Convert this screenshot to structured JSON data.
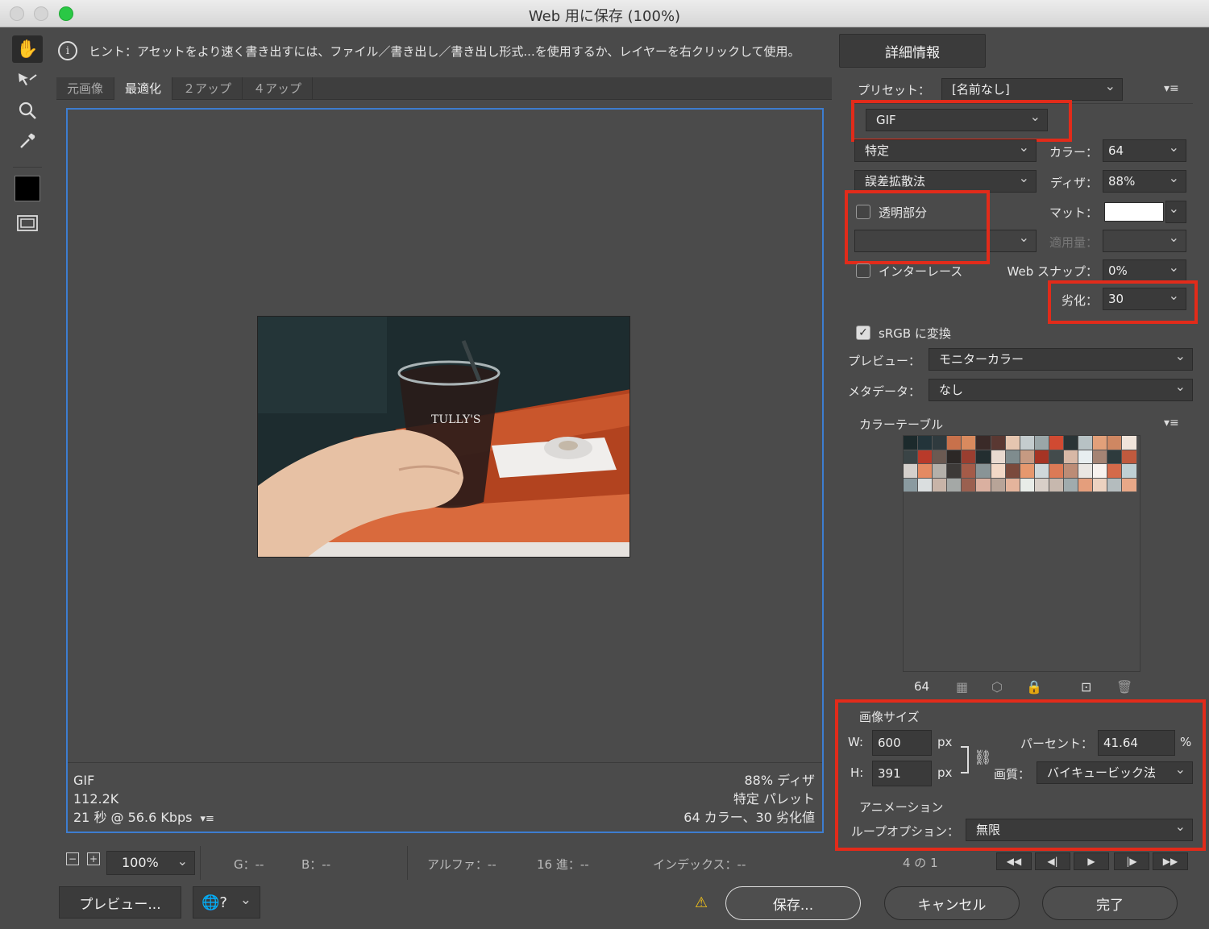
{
  "window": {
    "title": "Web 用に保存 (100%)"
  },
  "hint": {
    "text": "ヒント：アセットをより速く書き出すには、ファイル／書き出し／書き出し形式...を使用するか、レイヤーを右クリックして使用。"
  },
  "detail_button": "詳細情報",
  "tabs": [
    "元画像",
    "最適化",
    "２アップ",
    "４アップ"
  ],
  "canvas_info": {
    "format": "GIF",
    "size": "112.2K",
    "time": "21 秒 @ 56.6 Kbps",
    "dither": "88% ディザ",
    "palette": "特定 パレット",
    "colors": "64 カラー、30 劣化値"
  },
  "status": {
    "zoom": "100%",
    "g": "G：--",
    "b": "B：--",
    "alpha": "アルファ：--",
    "hex": "16 進：--",
    "index": "インデックス：--"
  },
  "buttons": {
    "preview": "プレビュー...",
    "save": "保存...",
    "cancel": "キャンセル",
    "done": "完了"
  },
  "settings": {
    "preset_label": "プリセット：",
    "preset_value": "[名前なし]",
    "format": "GIF",
    "reduction": "特定",
    "colors_label": "カラー：",
    "colors_value": "64",
    "dither_method": "誤差拡散法",
    "dither_label": "ディザ：",
    "dither_value": "88%",
    "transparency_label": "透明部分",
    "transparency_checked": false,
    "matte_label": "マット：",
    "amount_label": "適用量：",
    "interlace_label": "インターレース",
    "interlace_checked": false,
    "websnap_label": "Web スナップ：",
    "websnap_value": "0%",
    "lossy_label": "劣化：",
    "lossy_value": "30",
    "srgb_label": "sRGB に変換",
    "srgb_checked": true,
    "preview_label": "プレビュー：",
    "preview_value": "モニターカラー",
    "metadata_label": "メタデータ：",
    "metadata_value": "なし"
  },
  "color_table": {
    "title": "カラーテーブル",
    "count": "64",
    "colors": [
      "#1c2a2c",
      "#23343a",
      "#2f3a3e",
      "#c8714b",
      "#d98a5e",
      "#3a2a28",
      "#5a3832",
      "#e6c6b0",
      "#c4ccce",
      "#9aa6a8",
      "#d04a32",
      "#2a3436",
      "#b7c2c4",
      "#e2a07a",
      "#cf8762",
      "#f0e4da",
      "#3a4446",
      "#b93a2a",
      "#6b5a52",
      "#2c2826",
      "#9a3e30",
      "#232e30",
      "#e9dad0",
      "#7f8c8e",
      "#c69a82",
      "#a63424",
      "#434b4c",
      "#d8b8a6",
      "#e8eef0",
      "#a58474",
      "#2e3b3d",
      "#c05a3e",
      "#d4d0cc",
      "#e48a62",
      "#b4b0aa",
      "#3d3a38",
      "#a45b48",
      "#899496",
      "#f2d8c6",
      "#7a4a3c",
      "#e6986e",
      "#cfd8da",
      "#dc7a56",
      "#bc8c76",
      "#eae6e2",
      "#f8f2ee",
      "#d46a4a",
      "#c0d0d4",
      "#8a9aa0",
      "#dadedf",
      "#c8b4a8",
      "#a4a8a6",
      "#9a6050",
      "#dab0a0",
      "#b8a498",
      "#e4b49c",
      "#e8ece8",
      "#d8cfc8",
      "#c7b8ae",
      "#a0abad",
      "#e49e7c",
      "#ecd2c0",
      "#b4bcbe",
      "#e8a888"
    ],
    "icons": [
      "checker-icon",
      "cube-icon",
      "lock-icon",
      "new-color-icon",
      "trash-icon"
    ]
  },
  "image_size": {
    "title": "画像サイズ",
    "w_label": "W:",
    "w_value": "600",
    "h_label": "H:",
    "h_value": "391",
    "unit": "px",
    "percent_label": "パーセント：",
    "percent_value": "41.64",
    "percent_unit": "%",
    "quality_label": "画質：",
    "quality_value": "バイキュービック法"
  },
  "animation": {
    "title": "アニメーション",
    "loop_label": "ループオプション：",
    "loop_value": "無限",
    "frame": "4 の 1"
  },
  "highlight_color": "#e22b1a",
  "accent_color": "#3d7dd0"
}
